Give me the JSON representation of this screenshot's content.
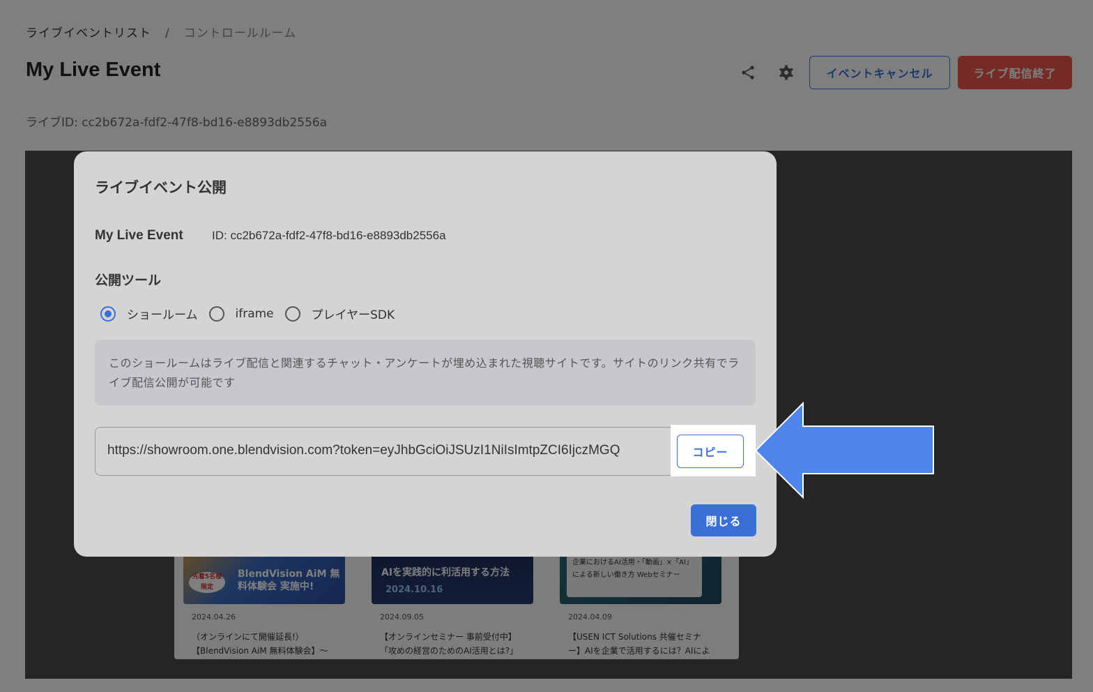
{
  "breadcrumb": {
    "parent": "ライブイベントリスト",
    "separator": "/",
    "current": "コントロールルーム"
  },
  "header": {
    "title": "My Live Event",
    "live_id": "ライブID: cc2b672a-fdf2-47f8-bd16-e8893db2556a",
    "share_icon": "share-icon",
    "settings_icon": "gear-icon",
    "cancel_label": "イベントキャンセル",
    "end_label": "ライブ配信終了"
  },
  "preview_cards": [
    {
      "thumb_text": "BlendVision AiM 無料体験会 実施中!",
      "badge": "先着5名様 限定",
      "date": "2024.04.26",
      "title_line1": "（オンラインにて開催延長!）",
      "title_line2": "【BlendVision AiM 無料体験会】〜"
    },
    {
      "thumb_text": "AIを実践的に利活用する方法",
      "thumb_sub": "2024.10.16",
      "date": "2024.09.05",
      "title_line1": "【オンラインセミナー 事前受付中】",
      "title_line2": "「攻めの経営のためのAI活用とは?」"
    },
    {
      "thumb_text": "企業におけるAI活用・「動画」×「AI」による新しい働き方 Webセミナー",
      "date": "2024.04.09",
      "title_line1": "【USEN ICT Solutions 共催セミナ",
      "title_line2": "ー】AIを企業で活用するには？AIによ"
    }
  ],
  "modal": {
    "title": "ライブイベント公開",
    "event_name": "My Live Event",
    "event_id": "ID: cc2b672a-fdf2-47f8-bd16-e8893db2556a",
    "section_label": "公開ツール",
    "options": [
      {
        "label": "ショールーム",
        "selected": true
      },
      {
        "label": "iframe",
        "selected": false
      },
      {
        "label": "プレイヤーSDK",
        "selected": false
      }
    ],
    "description": "このショールームはライブ配信と関連するチャット・アンケートが埋め込まれた視聴サイトです。サイトのリンク共有でライブ配信公開が可能です",
    "url": "https://showroom.one.blendvision.com?token=eyJhbGciOiJSUzI1NiIsImtpZCI6IjczMGQ",
    "copy_label": "コピー",
    "close_label": "閉じる"
  },
  "colors": {
    "accent": "#3b6fd8",
    "danger": "#e8594a",
    "arrow": "#4f86ec"
  }
}
